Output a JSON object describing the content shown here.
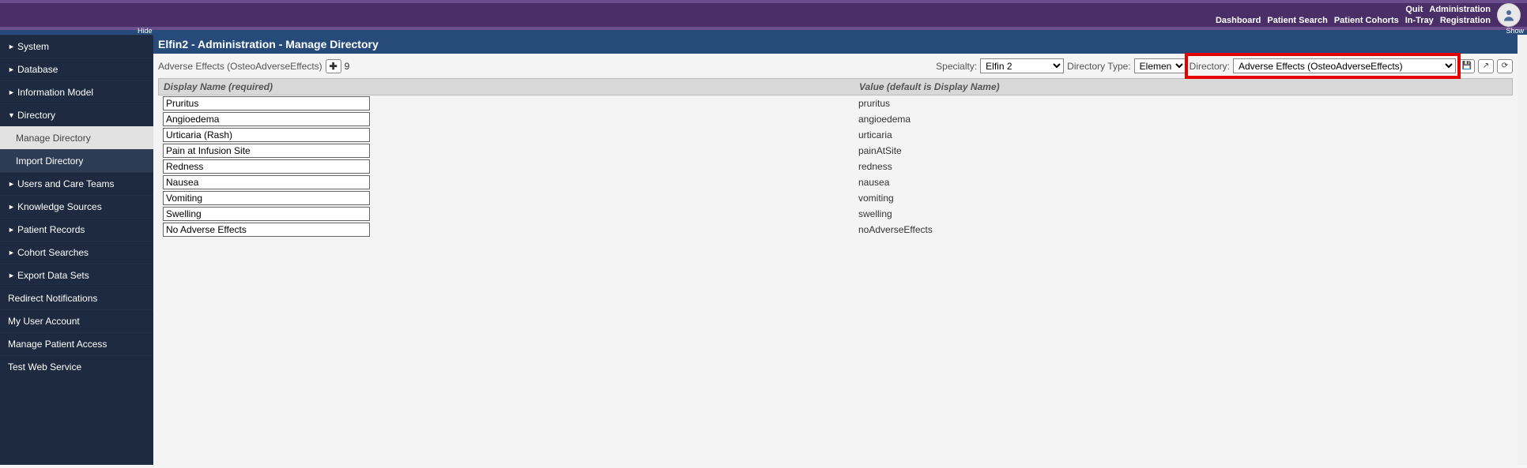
{
  "topLinks1": {
    "quit": "Quit",
    "admin": "Administration"
  },
  "topLinks2": {
    "dashboard": "Dashboard",
    "patientSearch": "Patient Search",
    "patientCohorts": "Patient Cohorts",
    "inTray": "In-Tray",
    "registration": "Registration"
  },
  "hide": "Hide",
  "show": "Show",
  "pageTitle": "Elfin2 - Administration - Manage Directory",
  "sidebar": {
    "items": [
      {
        "label": "System",
        "expanded": false
      },
      {
        "label": "Database",
        "expanded": false
      },
      {
        "label": "Information Model",
        "expanded": false
      },
      {
        "label": "Directory",
        "expanded": true,
        "children": [
          {
            "label": "Manage Directory",
            "active": true
          },
          {
            "label": "Import Directory",
            "active": false
          }
        ]
      },
      {
        "label": "Users and Care Teams",
        "expanded": false
      },
      {
        "label": "Knowledge Sources",
        "expanded": false
      },
      {
        "label": "Patient Records",
        "expanded": false
      },
      {
        "label": "Cohort Searches",
        "expanded": false
      },
      {
        "label": "Export Data Sets",
        "expanded": false
      }
    ],
    "flat": [
      {
        "label": "Redirect Notifications"
      },
      {
        "label": "My User Account"
      },
      {
        "label": "Manage Patient Access"
      },
      {
        "label": "Test Web Service"
      }
    ]
  },
  "toolbar": {
    "currentLabel": "Adverse Effects (OsteoAdverseEffects)",
    "count": "9",
    "specialtyLabel": "Specialty:",
    "specialtyValue": "Elfin 2",
    "dirTypeLabel": "Directory Type:",
    "dirTypeValue": "Element",
    "directoryLabel": "Directory:",
    "directoryValue": "Adverse Effects (OsteoAdverseEffects)"
  },
  "grid": {
    "headers": {
      "displayName": "Display Name (required)",
      "value": "Value (default is Display Name)"
    },
    "rows": [
      {
        "display": "Pruritus",
        "value": "pruritus"
      },
      {
        "display": "Angioedema",
        "value": "angioedema"
      },
      {
        "display": "Urticaria (Rash)",
        "value": "urticaria"
      },
      {
        "display": "Pain at Infusion Site",
        "value": "painAtSite"
      },
      {
        "display": "Redness",
        "value": "redness"
      },
      {
        "display": "Nausea",
        "value": "nausea"
      },
      {
        "display": "Vomiting",
        "value": "vomiting"
      },
      {
        "display": "Swelling",
        "value": "swelling"
      },
      {
        "display": "No Adverse Effects",
        "value": "noAdverseEffects"
      }
    ]
  }
}
